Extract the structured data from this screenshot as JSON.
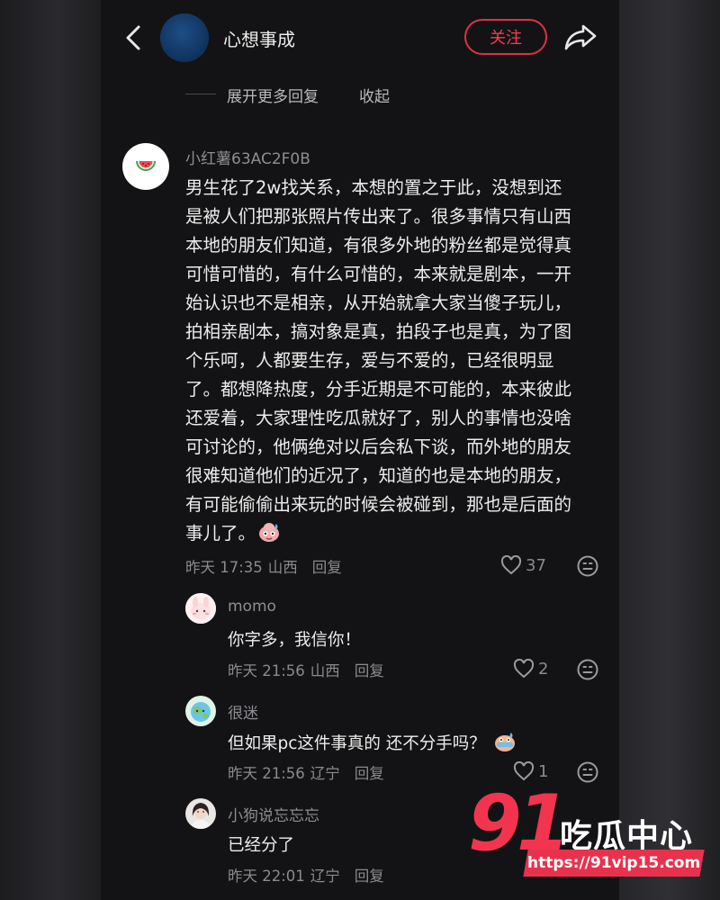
{
  "header": {
    "title": "心想事成",
    "follow_label": "关注"
  },
  "thread_controls": {
    "expand_label": "展开更多回复",
    "collapse_label": "收起"
  },
  "main_comment": {
    "author": "小红薯63AC2F0B",
    "lines": [
      "男生花了2w找关系，本想的置之于此，没想到还",
      "是被人们把那张照片传出来了。很多事情只有山西",
      "本地的朋友们知道，有很多外地的粉丝都是觉得真",
      "可惜可惜的，有什么可惜的，本来就是剧本，一开",
      "始认识也不是相亲，从开始就拿大家当傻子玩儿，",
      "拍相亲剧本，搞对象是真，拍段子也是真，为了图",
      "个乐呵，人都要生存，爱与不爱的，已经很明显",
      "了。都想降热度，分手近期是不可能的，本来彼此",
      "还爱着，大家理性吃瓜就好了，别人的事情也没啥",
      "可讨论的，他俩绝对以后会私下谈，而外地的朋友",
      "很难知道他们的近况了，知道的也是本地的朋友，",
      "有可能偷偷出来玩的时候会被碰到，那也是后面的",
      "事儿了。"
    ],
    "time": "昨天 17:35",
    "location": "山西",
    "reply_label": "回复",
    "likes": "37"
  },
  "replies": [
    {
      "author": "momo",
      "text": "你字多，我信你！",
      "time": "昨天 21:56",
      "location": "山西",
      "reply_label": "回复",
      "likes": "2"
    },
    {
      "author": "很迷",
      "text": "但如果pc这件事真的 还不分手吗？",
      "time": "昨天 21:56",
      "location": "辽宁",
      "reply_label": "回复",
      "likes": "1"
    },
    {
      "author": "小狗说忘忘忘",
      "text": "已经分了",
      "time": "昨天 22:01",
      "location": "辽宁",
      "reply_label": "回复",
      "likes": ""
    }
  ],
  "watermark": {
    "number": "91",
    "name": "吃瓜中心",
    "url": "https://91vip15.com"
  },
  "colors": {
    "accent": "#e03145",
    "background": "#131315",
    "text": "#ededed",
    "muted": "#8a8a8f"
  },
  "icons": [
    "back-arrow-icon",
    "share-icon",
    "heart-icon",
    "comment-emoji-icon",
    "watermelon-icon"
  ]
}
